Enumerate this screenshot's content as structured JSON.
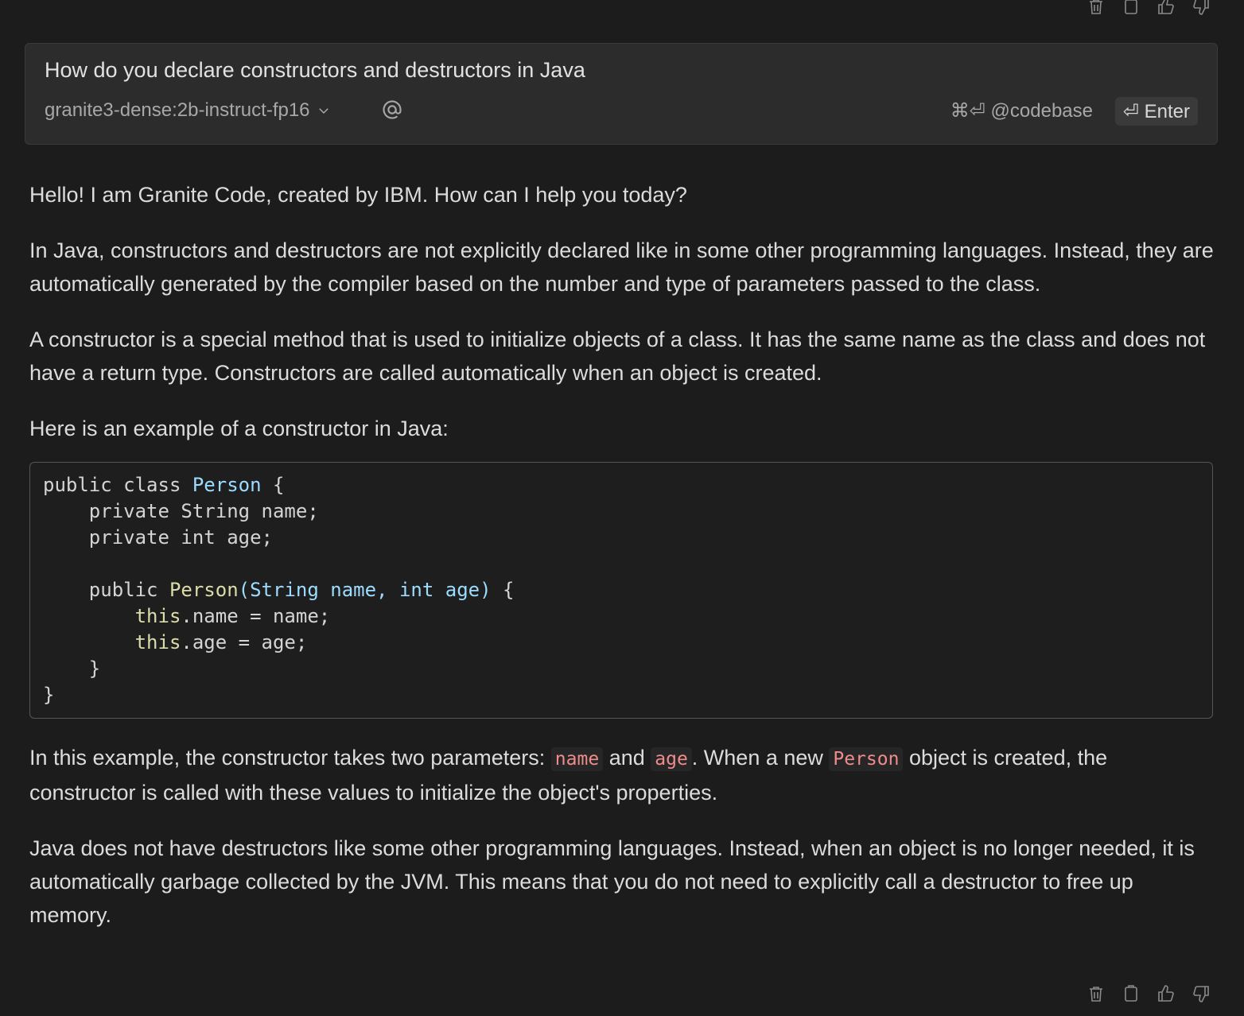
{
  "message_actions_top": [
    {
      "icon": "trash-icon"
    },
    {
      "icon": "clipboard-icon"
    },
    {
      "icon": "thumbs-up-icon"
    },
    {
      "icon": "thumbs-down-icon"
    }
  ],
  "prompt": {
    "text": "How do you declare constructors and destructors in Java",
    "model": "granite3-dense:2b-instruct-fp16",
    "codebase_hint": "⌘⏎ @codebase",
    "enter_label": "⏎ Enter"
  },
  "response": {
    "p1": "Hello! I am Granite Code, created by IBM. How can I help you today?",
    "p2": "In Java, constructors and destructors are not explicitly declared like in some other programming languages. Instead, they are automatically generated by the compiler based on the number and type of parameters passed to the class.",
    "p3": "A constructor is a special method that is used to initialize objects of a class. It has the same name as the class and does not have a return type. Constructors are called automatically when an object is created.",
    "p4": "Here is an example of a constructor in Java:",
    "code": {
      "l1_kw": "public class ",
      "l1_cls": "Person",
      "l1_end": " {",
      "l2": "    private String name;",
      "l3": "    private int age;",
      "l5_kw": "    public ",
      "l5_fn": "Person",
      "l5_params": "(String name, int age)",
      "l5_end": " {",
      "l6_this": "this",
      "l6_rest": ".name = name;",
      "l7_this": "this",
      "l7_rest": ".age = age;",
      "l8": "    }",
      "l9": "}"
    },
    "p5_a": "In this example, the constructor takes two parameters: ",
    "p5_code1": "name",
    "p5_b": " and ",
    "p5_code2": "age",
    "p5_c": ". When a new ",
    "p5_code3": "Person",
    "p5_d": " object is created, the constructor is called with these values to initialize the object's properties.",
    "p6": "Java does not have destructors like some other programming languages. Instead, when an object is no longer needed, it is automatically garbage collected by the JVM. This means that you do not need to explicitly call a destructor to free up memory."
  },
  "message_actions_bottom": [
    {
      "icon": "trash-icon"
    },
    {
      "icon": "clipboard-icon"
    },
    {
      "icon": "thumbs-up-icon"
    },
    {
      "icon": "thumbs-down-icon"
    }
  ]
}
